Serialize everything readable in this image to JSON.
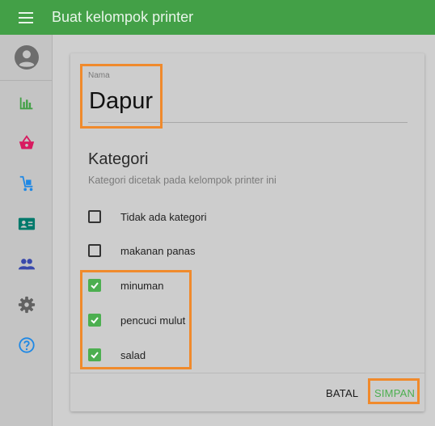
{
  "app_bar": {
    "title": "Buat kelompok printer"
  },
  "sidebar": {
    "items": [
      {
        "icon": "account-icon"
      },
      {
        "icon": "bar-chart-icon"
      },
      {
        "icon": "basket-icon"
      },
      {
        "icon": "cart-icon"
      },
      {
        "icon": "id-card-icon"
      },
      {
        "icon": "people-icon"
      },
      {
        "icon": "gear-icon"
      },
      {
        "icon": "help-icon"
      }
    ]
  },
  "form": {
    "name_label": "Nama",
    "name_value": "Dapur",
    "categories_title": "Kategori",
    "categories_subtitle": "Kategori dicetak pada kelompok printer ini",
    "options": [
      {
        "label": "Tidak ada kategori",
        "checked": false
      },
      {
        "label": "makanan panas",
        "checked": false
      },
      {
        "label": "minuman",
        "checked": true
      },
      {
        "label": "pencuci mulut",
        "checked": true
      },
      {
        "label": "salad",
        "checked": true
      }
    ]
  },
  "actions": {
    "cancel": "BATAL",
    "save": "SIMPAN"
  },
  "colors": {
    "app_bar": "#43a047",
    "accent": "#4caf50",
    "highlight": "#f08a2c"
  }
}
